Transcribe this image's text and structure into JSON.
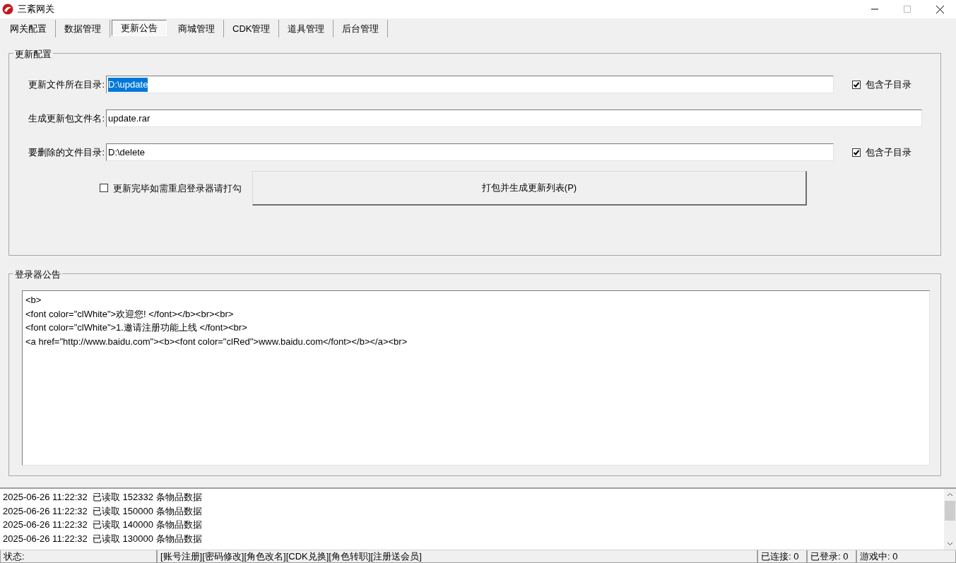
{
  "window": {
    "title": "三紊网关"
  },
  "tabs": [
    {
      "label": "网关配置",
      "selected": false
    },
    {
      "label": "数据管理",
      "selected": false
    },
    {
      "label": "更新公告",
      "selected": true
    },
    {
      "label": "商城管理",
      "selected": false
    },
    {
      "label": "CDK管理",
      "selected": false
    },
    {
      "label": "道具管理",
      "selected": false
    },
    {
      "label": "后台管理",
      "selected": false
    }
  ],
  "update_config": {
    "title": "更新配置",
    "rows": [
      {
        "label": "更新文件所在目录:",
        "value": "D:\\update",
        "selected": true,
        "checkbox": {
          "label": "包含子目录",
          "checked": true
        }
      },
      {
        "label": "生成更新包文件名:",
        "value": "update.rar",
        "selected": false
      },
      {
        "label": "要删除的文件目录:",
        "value": "D:\\delete",
        "selected": false,
        "checkbox": {
          "label": "包含子目录",
          "checked": true
        }
      }
    ],
    "restart_checkbox": {
      "label": "更新完毕如需重启登录器请打勾",
      "checked": false
    },
    "pack_button": "打包并生成更新列表(P)"
  },
  "notice": {
    "title": "登录器公告",
    "lines": [
      "<b>",
      "<font color=\"clWhite\">欢迎您! </font></b><br><br>",
      "<font color=\"clWhite\">1.邀请注册功能上线 </font><br>",
      "<a href=\"http://www.baidu.com\"><b><font color=\"clRed\">www.baidu.com</font></b></a><br>"
    ]
  },
  "log": [
    "2025-06-26 11:22:32  已读取 152332 条物品数据",
    "2025-06-26 11:22:32  已读取 150000 条物品数据",
    "2025-06-26 11:22:32  已读取 140000 条物品数据",
    "2025-06-26 11:22:32  已读取 130000 条物品数据"
  ],
  "status_bar": [
    "状态:",
    "[账号注册][密码修改][角色改名][CDK兑换][角色转职][注册送会员]",
    "已连接: 0",
    "已登录: 0",
    "游戏中: 0"
  ]
}
